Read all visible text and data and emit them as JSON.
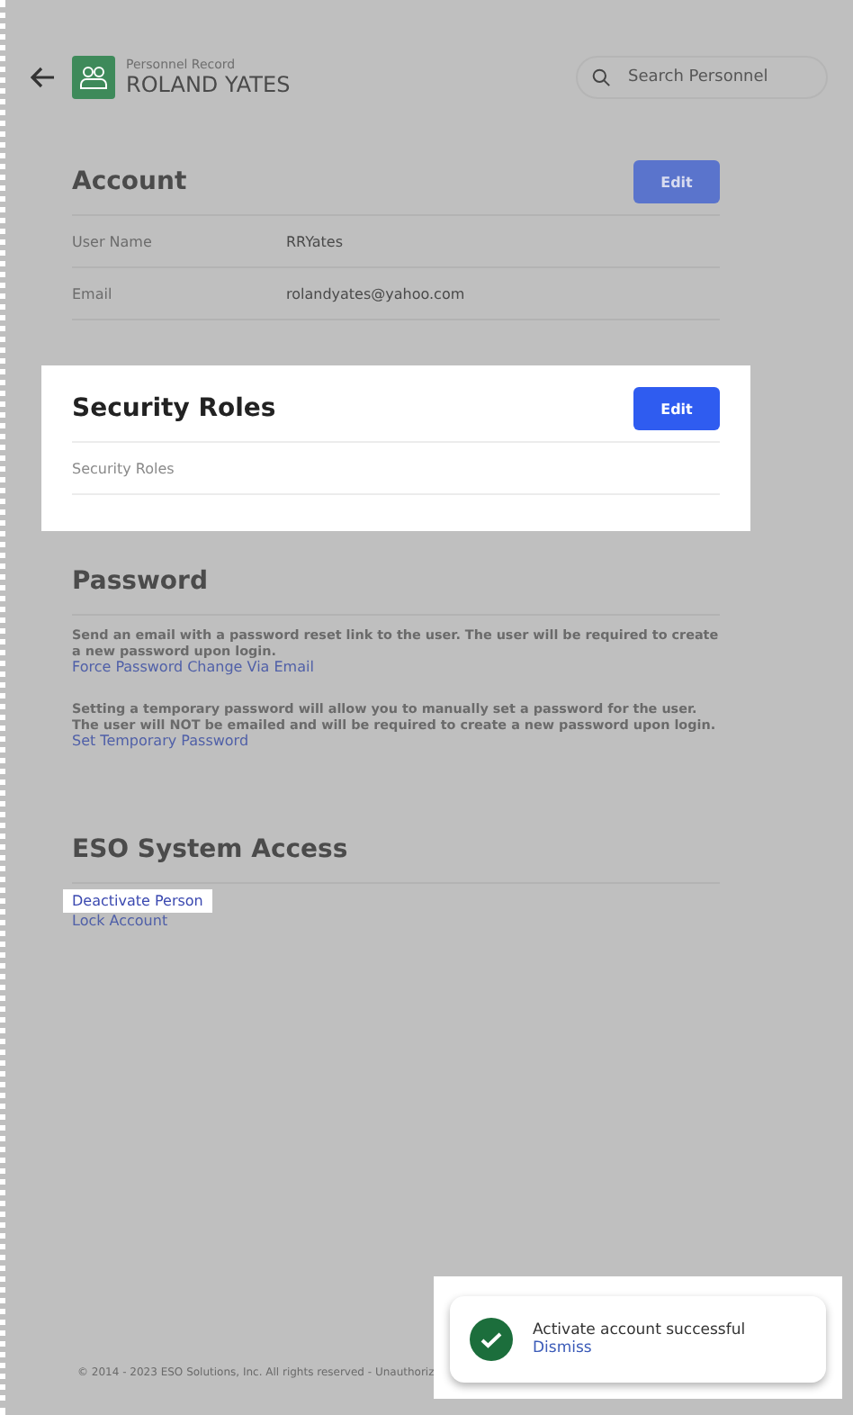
{
  "header": {
    "subtitle": "Personnel Record",
    "title": "ROLAND YATES",
    "search": {
      "placeholder": "Search Personnel"
    }
  },
  "sections": [
    {
      "kind": "fields",
      "title": "Account",
      "spotlight": false,
      "button": "Edit",
      "rows": [
        {
          "label": "User Name",
          "value": "RRYates"
        },
        {
          "label": "Email",
          "value": "rolandyates@yahoo.com"
        }
      ]
    },
    {
      "kind": "fields",
      "title": "Security Roles",
      "spotlight": true,
      "button": "Edit",
      "rows": [
        {
          "label": "Security Roles"
        }
      ]
    },
    {
      "kind": "actions",
      "title": "Password",
      "spotlight": false,
      "items": [
        {
          "text": "Send an email with a password reset link to the user. The user will be required to create a new password upon login.",
          "link": "Force Password Change Via Email"
        },
        {
          "text": "Setting a temporary password will allow you to manually set a password for the user. The user will NOT be emailed and will be required to create a new password upon login.",
          "link": "Set Temporary Password"
        }
      ]
    },
    {
      "kind": "links",
      "title": "ESO System Access",
      "spotlight": false,
      "links": [
        {
          "label": "Deactivate Person",
          "spotlight": true
        },
        {
          "label": "Lock Account",
          "spotlight": false
        }
      ]
    }
  ],
  "footer": "© 2014 - 2023 ESO Solutions, Inc. All rights reserved - Unauthoriz",
  "toast": {
    "message": "Activate account successful",
    "action": "Dismiss"
  }
}
